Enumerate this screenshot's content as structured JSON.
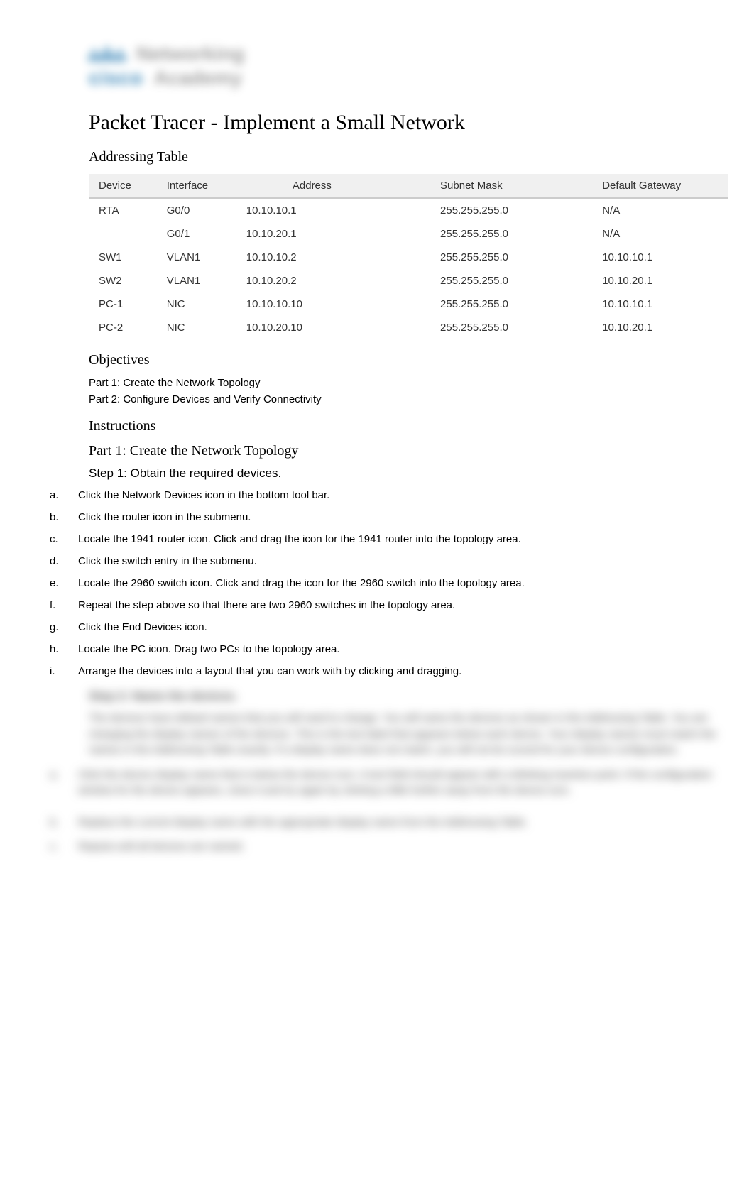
{
  "logo": {
    "top_text": "Networking",
    "bottom_text": "Academy",
    "brand": "cisco"
  },
  "title": "Packet Tracer - Implement a Small Network",
  "addressing_table": {
    "heading": "Addressing Table",
    "headers": [
      "Device",
      "Interface",
      "Address",
      "Subnet Mask",
      "Default Gateway"
    ],
    "rows": [
      {
        "device": "RTA",
        "interface": "G0/0",
        "address": "10.10.10.1",
        "mask": "255.255.255.0",
        "gateway": "N/A"
      },
      {
        "device": "",
        "interface": "G0/1",
        "address": "10.10.20.1",
        "mask": "255.255.255.0",
        "gateway": "N/A"
      },
      {
        "device": "SW1",
        "interface": "VLAN1",
        "address": "10.10.10.2",
        "mask": "255.255.255.0",
        "gateway": "10.10.10.1"
      },
      {
        "device": "SW2",
        "interface": "VLAN1",
        "address": "10.10.20.2",
        "mask": "255.255.255.0",
        "gateway": "10.10.20.1"
      },
      {
        "device": "PC-1",
        "interface": "NIC",
        "address": "10.10.10.10",
        "mask": "255.255.255.0",
        "gateway": "10.10.10.1"
      },
      {
        "device": "PC-2",
        "interface": "NIC",
        "address": "10.10.20.10",
        "mask": "255.255.255.0",
        "gateway": "10.10.20.1"
      }
    ]
  },
  "objectives": {
    "heading": "Objectives",
    "items": [
      "Part 1: Create the Network Topology",
      "Part 2: Configure Devices and Verify Connectivity"
    ]
  },
  "instructions": {
    "heading": "Instructions",
    "part1": {
      "heading": "Part 1: Create the Network Topology",
      "step1": {
        "heading": "Step 1: Obtain the required devices.",
        "items": [
          {
            "marker": "a.",
            "text_before": "Click the ",
            "bold1": "Network Devices",
            "text_mid": " icon in the bottom tool bar.",
            "bold2": "",
            "text_after": ""
          },
          {
            "marker": "b.",
            "text_before": "Click the router icon in the submenu.",
            "bold1": "",
            "text_mid": "",
            "bold2": "",
            "text_after": ""
          },
          {
            "marker": "c.",
            "text_before": "Locate the ",
            "bold1": "1941",
            "text_mid": " router icon. Click and drag the icon for the 1941 router into the topology area.",
            "bold2": "",
            "text_after": ""
          },
          {
            "marker": "d.",
            "text_before": "Click the switch entry in the submenu.",
            "bold1": "",
            "text_mid": "",
            "bold2": "",
            "text_after": ""
          },
          {
            "marker": "e.",
            "text_before": "Locate the ",
            "bold1": "2960",
            "text_mid": " switch icon. Click and drag the icon for the 2960 switch into the topology area.",
            "bold2": "",
            "text_after": ""
          },
          {
            "marker": "f.",
            "text_before": "Repeat the step above so that there are ",
            "bold1": "two",
            "text_mid": " 2960 switches in the topology area.",
            "bold2": "",
            "text_after": ""
          },
          {
            "marker": "g.",
            "text_before": "Click the ",
            "bold1": "End Devices",
            "text_mid": " icon.",
            "bold2": "",
            "text_after": ""
          },
          {
            "marker": "h.",
            "text_before": "Locate the PC icon. Drag ",
            "bold1": "two",
            "text_mid": " PCs to the topology area.",
            "bold2": "",
            "text_after": ""
          },
          {
            "marker": "i.",
            "text_before": "Arrange the devices into a layout that you can work with by clicking and dragging.",
            "bold1": "",
            "text_mid": "",
            "bold2": "",
            "text_after": ""
          }
        ]
      },
      "step2_blurred": {
        "heading": "Step 2: Name the devices.",
        "para": "The devices have default names that you will need to change. You will name the devices as shown in the Addressing Table. You are changing the display names of the devices. This is the text label that appears below each device. Your display names must match the names in the Addressing Table exactly. If a display name does not match, you will not be scored for your device configuration.",
        "items": [
          {
            "marker": "a.",
            "text": "Click the device display name that is below the device icon. A text field should appear with a blinking insertion point. If the configuration window for the device appears, close it and try again by clicking a little further away from the device icon."
          },
          {
            "marker": "b.",
            "text": "Replace the current display name with the appropriate display name from the Addressing Table."
          },
          {
            "marker": "c.",
            "text": "Repeat until all devices are named."
          }
        ]
      }
    }
  }
}
